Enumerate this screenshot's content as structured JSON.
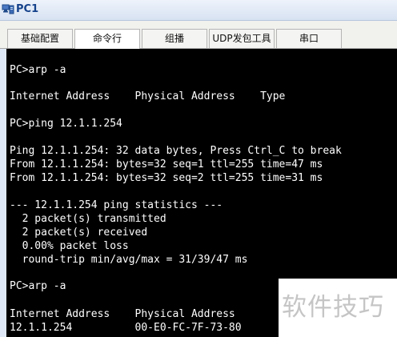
{
  "window": {
    "title": "PC1",
    "icon": "pc-computer-icon"
  },
  "tabs": [
    {
      "label": "基础配置",
      "active": false
    },
    {
      "label": "命令行",
      "active": true
    },
    {
      "label": "组播",
      "active": false
    },
    {
      "label": "UDP发包工具",
      "active": false
    },
    {
      "label": "串口",
      "active": false
    }
  ],
  "terminal": {
    "lines": [
      "PC>arp -a",
      "Internet Address    Physical Address    Type",
      "PC>ping 12.1.1.254",
      "Ping 12.1.1.254: 32 data bytes, Press Ctrl_C to break",
      "From 12.1.1.254: bytes=32 seq=1 ttl=255 time=47 ms",
      "From 12.1.1.254: bytes=32 seq=2 ttl=255 time=31 ms",
      "--- 12.1.1.254 ping statistics ---",
      "  2 packet(s) transmitted",
      "  2 packet(s) received",
      "  0.00% packet loss",
      "  round-trip min/avg/max = 31/39/47 ms",
      "PC>arp -a",
      "Internet Address    Physical Address",
      "12.1.1.254          00-E0-FC-7F-73-80"
    ],
    "background_color": "#000000",
    "text_color": "#ffffff"
  },
  "watermark": {
    "text": "软件技巧"
  }
}
